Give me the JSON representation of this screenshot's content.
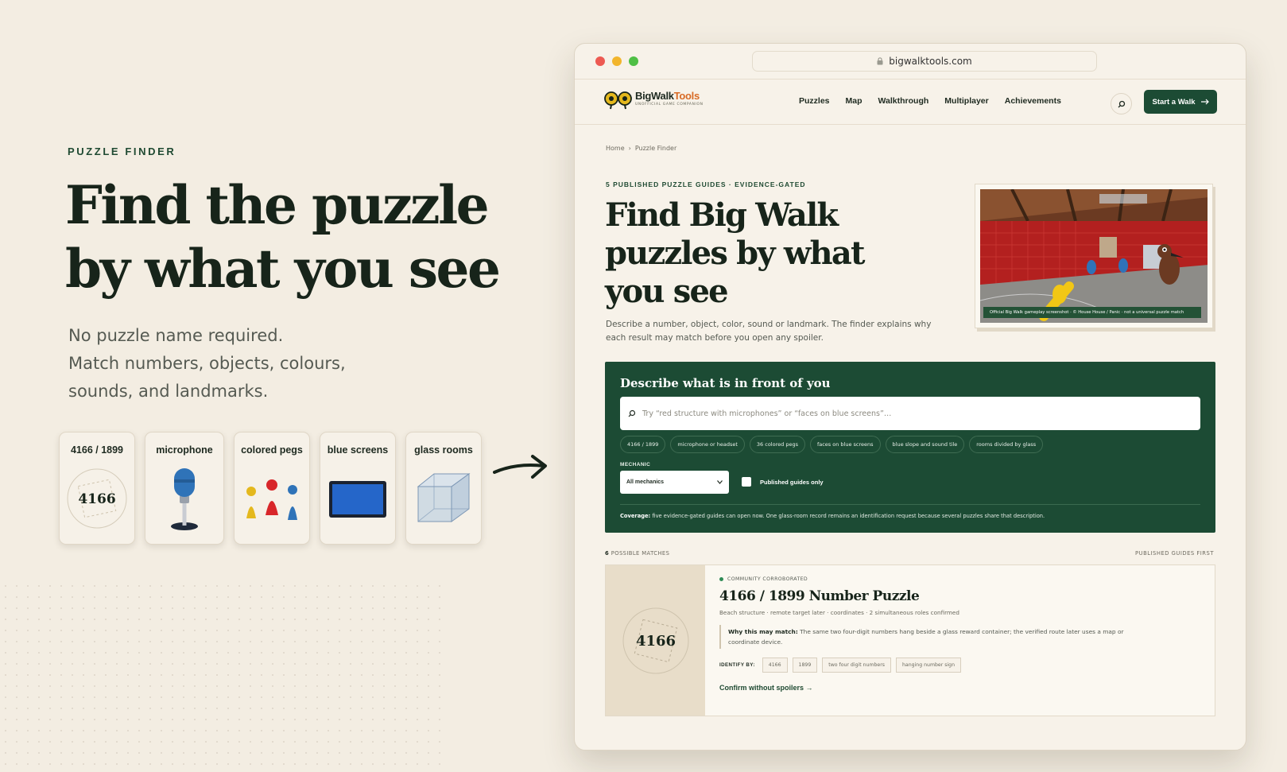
{
  "hero": {
    "eyebrow": "PUZZLE FINDER",
    "title_line1": "Find the puzzle",
    "title_line2": "by what you see",
    "sub_line1": "No puzzle name required.",
    "sub_line2": "Match numbers, objects, colours,",
    "sub_line3": "sounds, and landmarks.",
    "cards": [
      {
        "label": "4166 / 1899",
        "icon": "number-stamp-icon",
        "stamp_text": "4166"
      },
      {
        "label": "microphone",
        "icon": "microphone-icon"
      },
      {
        "label": "colored pegs",
        "icon": "colored-pegs-icon"
      },
      {
        "label": "blue screens",
        "icon": "blue-screen-icon"
      },
      {
        "label": "glass rooms",
        "icon": "glass-cube-icon"
      }
    ]
  },
  "browser": {
    "url": "bigwalktools.com",
    "logo": {
      "name_a": "BigWalk",
      "name_b": "Tools",
      "tagline": "UNOFFICIAL GAME COMPANION"
    },
    "nav": [
      "Puzzles",
      "Map",
      "Walkthrough",
      "Multiplayer",
      "Achievements"
    ],
    "cta": "Start a Walk",
    "breadcrumb": {
      "home": "Home",
      "sep": "›",
      "current": "Puzzle Finder"
    },
    "eyebrow": "5 PUBLISHED PUZZLE GUIDES · EVIDENCE-GATED",
    "title_line1": "Find Big Walk",
    "title_line2": "puzzles by what",
    "title_line3": "you see",
    "description": "Describe a number, object, color, sound or landmark. The finder explains why each result may match before you open any spoiler.",
    "screenshot_caption": "Official Big Walk gameplay screenshot · © House House / Panic · not a universal puzzle match",
    "panel": {
      "title": "Describe what is in front of you",
      "search_placeholder": "Try “red structure with microphones” or “faces on blue screens”…",
      "chips": [
        "4166 / 1899",
        "microphone or headset",
        "36 colored pegs",
        "faces on blue screens",
        "blue slope and sound tile",
        "rooms divided by glass"
      ],
      "mechanic_label": "MECHANIC",
      "mechanic_value": "All mechanics",
      "published_only_label": "Published guides only",
      "coverage_label": "Coverage:",
      "coverage_text": "five evidence-gated guides can open now. One glass-room record remains an identification request because several puzzles share that description."
    },
    "results": {
      "count": "6",
      "count_label": "POSSIBLE MATCHES",
      "sort_label": "PUBLISHED GUIDES FIRST",
      "items": [
        {
          "badge": "COMMUNITY CORROBORATED",
          "thumb_text": "4166",
          "title": "4166 / 1899 Number Puzzle",
          "meta": "Beach structure · remote target later · coordinates · 2 simultaneous roles confirmed",
          "why_label": "Why this may match:",
          "why_text": "The same two four-digit numbers hang beside a glass reward container; the verified route later uses a map or coordinate device.",
          "identify_label": "IDENTIFY BY:",
          "tags": [
            "4166",
            "1899",
            "two four digit numbers",
            "hanging number sign"
          ],
          "link": "Confirm without spoilers →"
        }
      ]
    }
  },
  "colors": {
    "brand_green": "#1c4b34",
    "accent_orange": "#d86a25",
    "background": "#f3ede2"
  }
}
